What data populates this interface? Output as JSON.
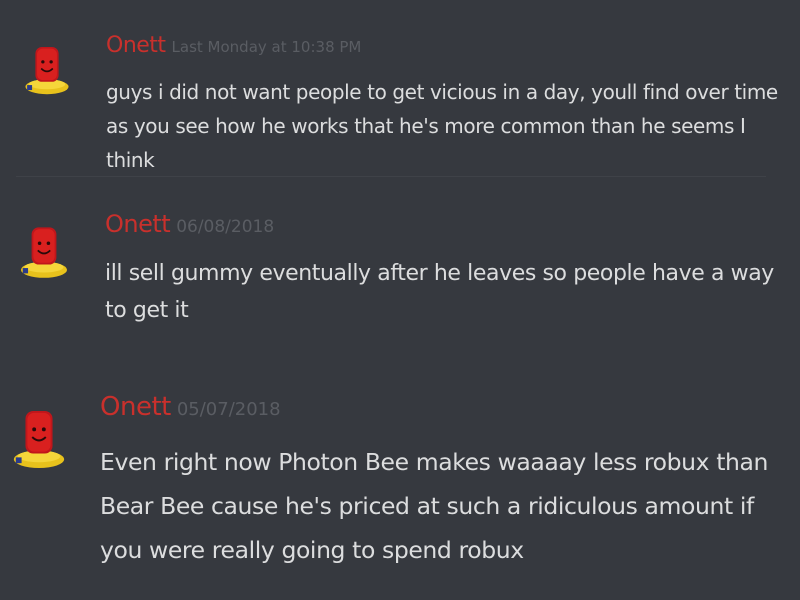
{
  "messages": [
    {
      "username": "Onett",
      "timestamp": "Last Monday at 10:38 PM",
      "text": "guys i did not want people to get vicious in a day, youll find over time as you see how he works that he's more common than he seems I think"
    },
    {
      "username": "Onett",
      "timestamp": "06/08/2018",
      "text": "ill sell gummy eventually after he leaves so people have a way to get it"
    },
    {
      "username": "Onett",
      "timestamp": "05/07/2018",
      "text": "Even right now Photon Bee makes waaaay less robux than Bear Bee cause he's priced at such a ridiculous amount if you were really going to spend robux"
    }
  ],
  "colors": {
    "background": "#36393f",
    "username": "#c9302c",
    "timestamp": "#5a5d63",
    "text": "#dcddde"
  },
  "icons": {
    "avatar": "roblox-avatar-icon"
  }
}
